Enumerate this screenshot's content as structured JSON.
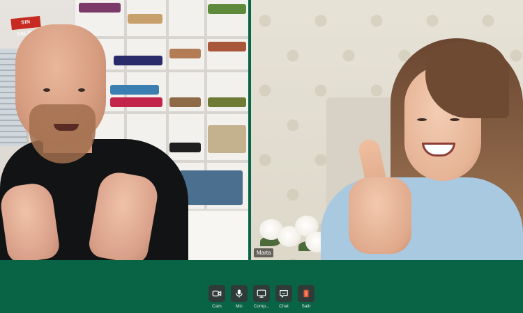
{
  "participants": [
    {
      "name": "",
      "sign_text": "SIN SALIDA"
    },
    {
      "name": "Marta"
    }
  ],
  "controls": [
    {
      "id": "cam",
      "label": "Cam",
      "icon": "camera-icon"
    },
    {
      "id": "mic",
      "label": "Mic",
      "icon": "microphone-icon"
    },
    {
      "id": "share",
      "label": "Comp...",
      "icon": "screen-share-icon"
    },
    {
      "id": "chat",
      "label": "Chat",
      "icon": "chat-icon"
    },
    {
      "id": "leave",
      "label": "Salir",
      "icon": "leave-icon"
    }
  ],
  "colors": {
    "background": "#086445",
    "control_button": "#2f3b39",
    "leave_accent": "#e4573b"
  }
}
